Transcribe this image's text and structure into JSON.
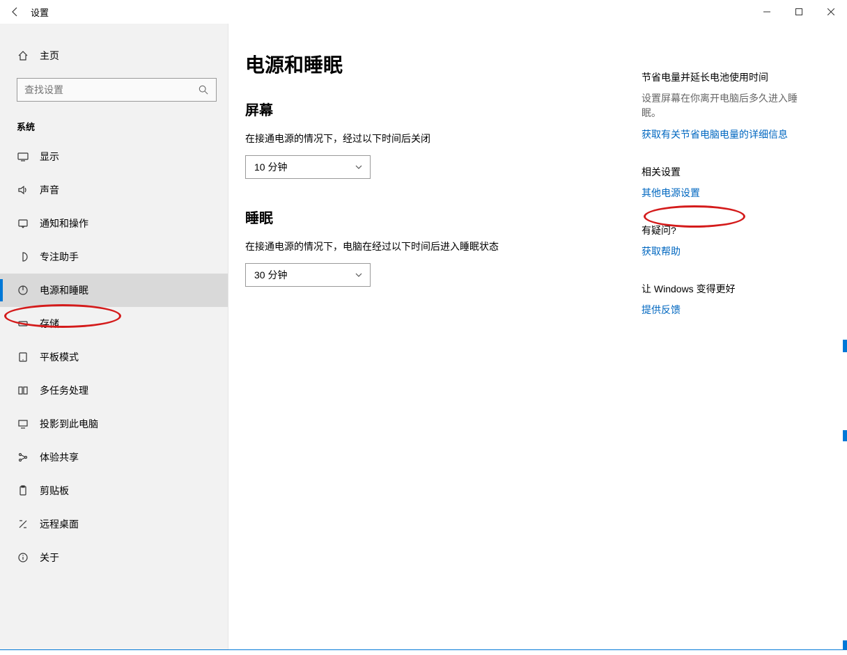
{
  "titlebar": {
    "title": "设置"
  },
  "sidebar": {
    "home": "主页",
    "search_placeholder": "查找设置",
    "category": "系统",
    "items": [
      {
        "label": "显示"
      },
      {
        "label": "声音"
      },
      {
        "label": "通知和操作"
      },
      {
        "label": "专注助手"
      },
      {
        "label": "电源和睡眠",
        "active": true
      },
      {
        "label": "存储"
      },
      {
        "label": "平板模式"
      },
      {
        "label": "多任务处理"
      },
      {
        "label": "投影到此电脑"
      },
      {
        "label": "体验共享"
      },
      {
        "label": "剪贴板"
      },
      {
        "label": "远程桌面"
      },
      {
        "label": "关于"
      }
    ]
  },
  "main": {
    "title": "电源和睡眠",
    "screen": {
      "heading": "屏幕",
      "desc": "在接通电源的情况下，经过以下时间后关闭",
      "value": "10 分钟"
    },
    "sleep": {
      "heading": "睡眠",
      "desc": "在接通电源的情况下，电脑在经过以下时间后进入睡眠状态",
      "value": "30 分钟"
    }
  },
  "rail": {
    "save": {
      "heading": "节省电量并延长电池使用时间",
      "text": "设置屏幕在你离开电脑后多久进入睡眠。",
      "link": "获取有关节省电脑电量的详细信息"
    },
    "related": {
      "heading": "相关设置",
      "link": "其他电源设置"
    },
    "question": {
      "heading": "有疑问?",
      "link": "获取帮助"
    },
    "feedback": {
      "heading": "让 Windows 变得更好",
      "link": "提供反馈"
    }
  }
}
